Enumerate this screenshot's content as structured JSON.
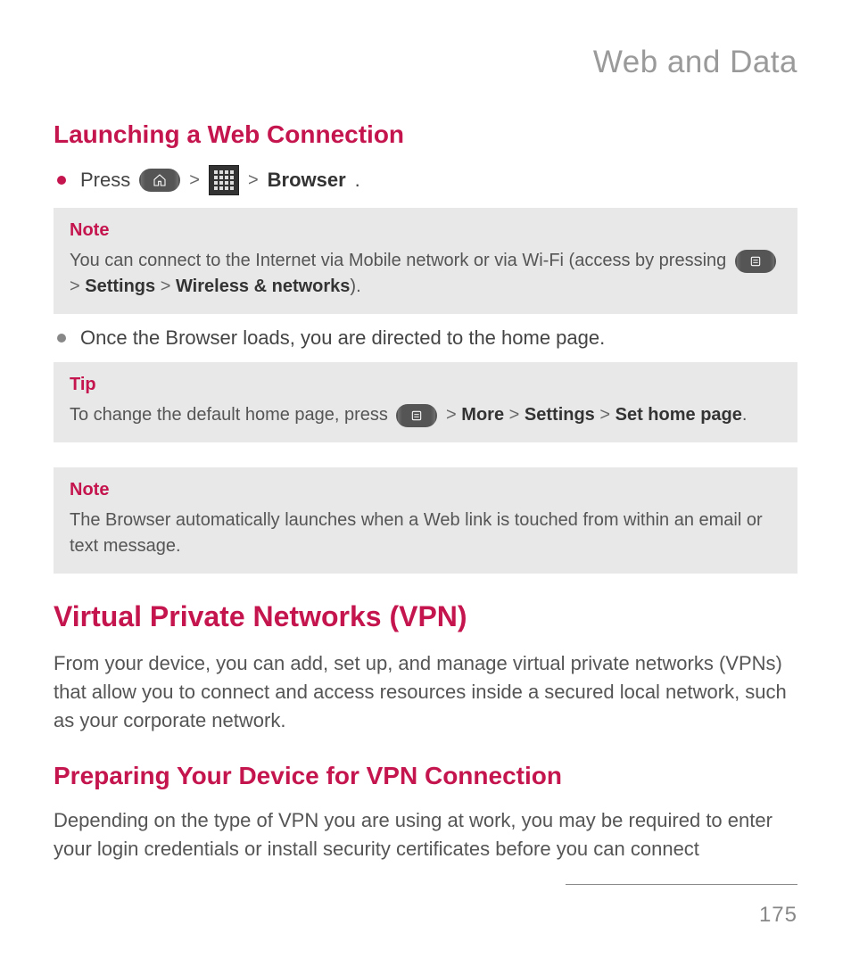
{
  "chapter_title": "Web and Data",
  "section1": {
    "heading": "Launching a Web Connection",
    "bullet1": {
      "prefix": "Press",
      "sep": ">",
      "end": "Browser",
      "period": "."
    },
    "note1": {
      "label": "Note",
      "text_before": "You can connect to the Internet via Mobile network or via Wi-Fi (access by pressing ",
      "sep1": ">",
      "settings": "Settings",
      "sep2": ">",
      "wireless": "Wireless & networks",
      "close": ")."
    },
    "bullet2": "Once the Browser loads, you are directed to the home page.",
    "tip": {
      "label": "Tip",
      "text_before": "To change the default home page, press ",
      "sep": ">",
      "more": "More",
      "settings": "Settings",
      "set_home": "Set home page",
      "period": "."
    },
    "note2": {
      "label": "Note",
      "text": "The Browser automatically launches when a Web link is touched from within an email or text message."
    }
  },
  "section2": {
    "heading": "Virtual Private Networks (VPN)",
    "body": "From your device, you can add, set up, and manage virtual private networks (VPNs) that allow you to connect and access resources inside a secured local network, such as your corporate network."
  },
  "section3": {
    "heading": "Preparing Your Device for VPN Connection",
    "body": "Depending on the type of VPN you are using at work, you may be required to enter your login credentials or install security certificates before you can connect"
  },
  "page_number": "175"
}
